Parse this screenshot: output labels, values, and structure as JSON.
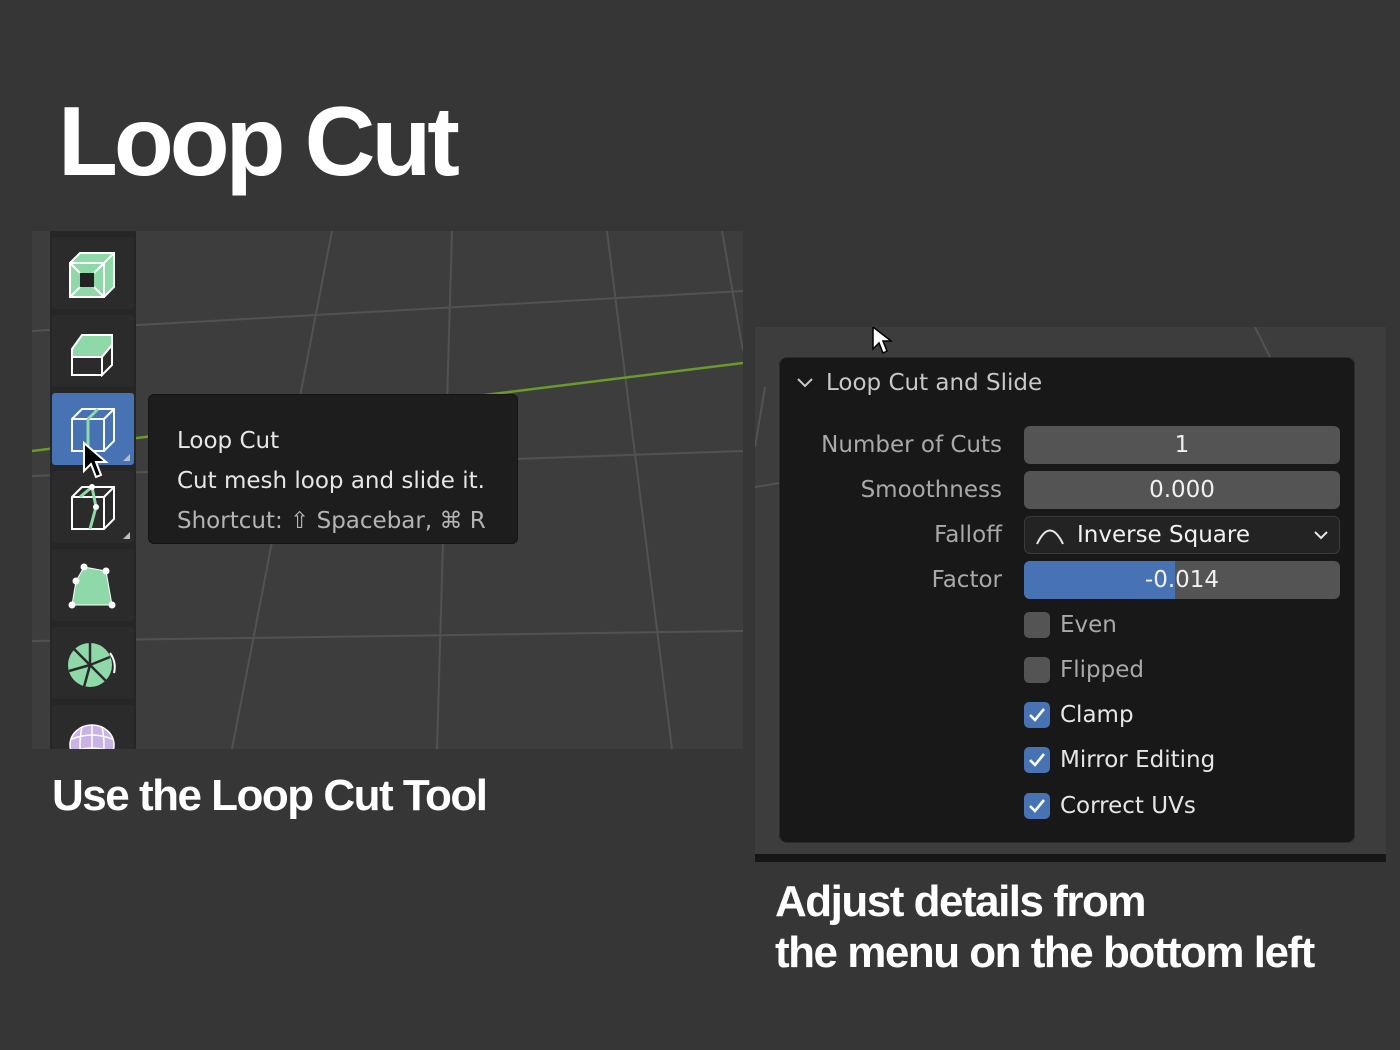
{
  "title": "Loop Cut",
  "caption_left": "Use the Loop Cut Tool",
  "caption_right": "Adjust details from\nthe menu on the bottom left",
  "toolbar": {
    "tools": [
      {
        "name": "inset-faces-icon",
        "active": false
      },
      {
        "name": "bevel-icon",
        "active": false
      },
      {
        "name": "loop-cut-icon",
        "active": true
      },
      {
        "name": "knife-icon",
        "active": false
      },
      {
        "name": "poly-build-icon",
        "active": false
      },
      {
        "name": "spin-icon",
        "active": false
      },
      {
        "name": "smooth-icon",
        "active": false
      }
    ]
  },
  "tooltip": {
    "title": "Loop Cut",
    "description": "Cut mesh loop and slide it.",
    "shortcut": "Shortcut: ⇧ Spacebar, ⌘ R"
  },
  "operator_panel": {
    "header": "Loop Cut and Slide",
    "fields": {
      "number_of_cuts": {
        "label": "Number of Cuts",
        "value": "1"
      },
      "smoothness": {
        "label": "Smoothness",
        "value": "0.000"
      },
      "falloff": {
        "label": "Falloff",
        "value": "Inverse Square"
      },
      "factor": {
        "label": "Factor",
        "value": "-0.014",
        "fill_fraction": 0.478
      }
    },
    "checkboxes": [
      {
        "label": "Even",
        "checked": false
      },
      {
        "label": "Flipped",
        "checked": false
      },
      {
        "label": "Clamp",
        "checked": true
      },
      {
        "label": "Mirror Editing",
        "checked": true
      },
      {
        "label": "Correct UVs",
        "checked": true
      }
    ]
  },
  "colors": {
    "accent": "#4772b3",
    "tool_green": "#8fd9a8",
    "axis_green": "#6a9a2a"
  }
}
